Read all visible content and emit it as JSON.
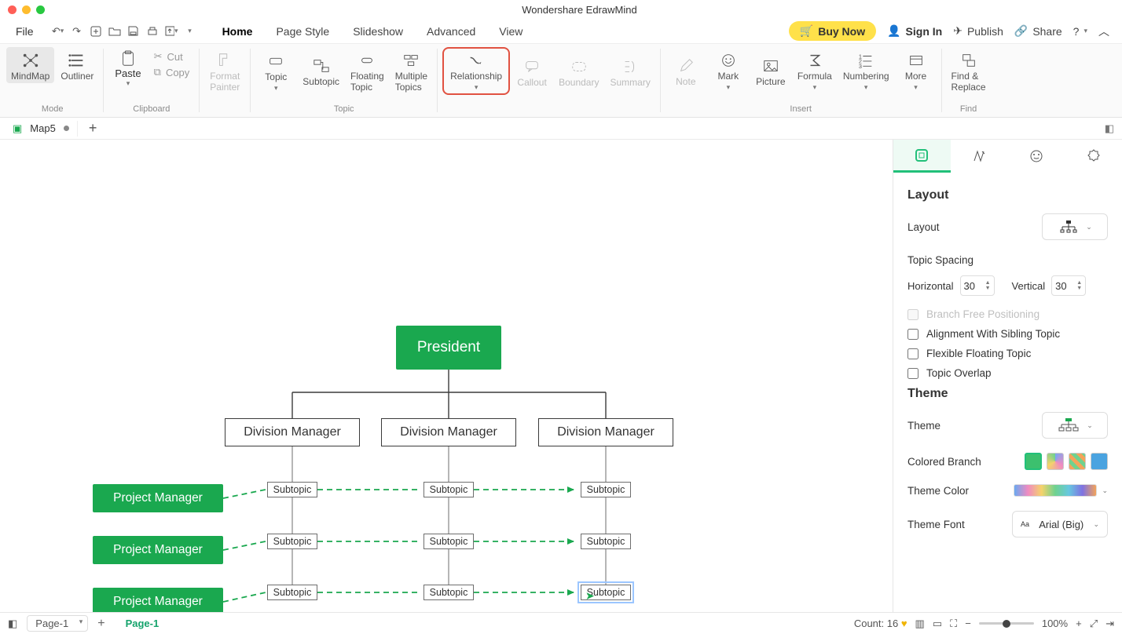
{
  "app_title": "Wondershare EdrawMind",
  "menu": {
    "file": "File"
  },
  "main_tabs": [
    "Home",
    "Page Style",
    "Slideshow",
    "Advanced",
    "View"
  ],
  "main_tab_active": 0,
  "topbar": {
    "buy": "Buy Now",
    "signin": "Sign In",
    "publish": "Publish",
    "share": "Share"
  },
  "ribbon": {
    "mode": {
      "mindmap": "MindMap",
      "outliner": "Outliner",
      "label": "Mode"
    },
    "clipboard": {
      "paste": "Paste",
      "cut": "Cut",
      "copy": "Copy",
      "label": "Clipboard"
    },
    "format_painter": "Format\nPainter",
    "topic_group": {
      "topic": "Topic",
      "subtopic": "Subtopic",
      "floating": "Floating\nTopic",
      "multiple": "Multiple\nTopics",
      "label": "Topic"
    },
    "relationship": "Relationship",
    "callout": "Callout",
    "boundary": "Boundary",
    "summary": "Summary",
    "insert": {
      "note": "Note",
      "mark": "Mark",
      "picture": "Picture",
      "formula": "Formula",
      "numbering": "Numbering",
      "more": "More",
      "label": "Insert"
    },
    "find": {
      "findreplace": "Find &\nReplace",
      "label": "Find"
    }
  },
  "doc_tab": {
    "name": "Map5"
  },
  "diagram": {
    "president": "President",
    "division": "Division Manager",
    "subtopic": "Subtopic",
    "pm": "Project Manager"
  },
  "side": {
    "layout_h": "Layout",
    "layout_label": "Layout",
    "topic_spacing": "Topic Spacing",
    "horizontal": "Horizontal",
    "h_val": "30",
    "vertical": "Vertical",
    "v_val": "30",
    "branch_free": "Branch Free Positioning",
    "align_sibling": "Alignment With Sibling Topic",
    "flex_float": "Flexible Floating Topic",
    "overlap": "Topic Overlap",
    "theme_h": "Theme",
    "theme_label": "Theme",
    "colored_branch": "Colored Branch",
    "theme_color": "Theme Color",
    "theme_font": "Theme Font",
    "font_val": "Arial (Big)"
  },
  "status": {
    "page_dd": "Page-1",
    "active_page": "Page-1",
    "count_label": "Count: 16",
    "zoom": "100%"
  }
}
